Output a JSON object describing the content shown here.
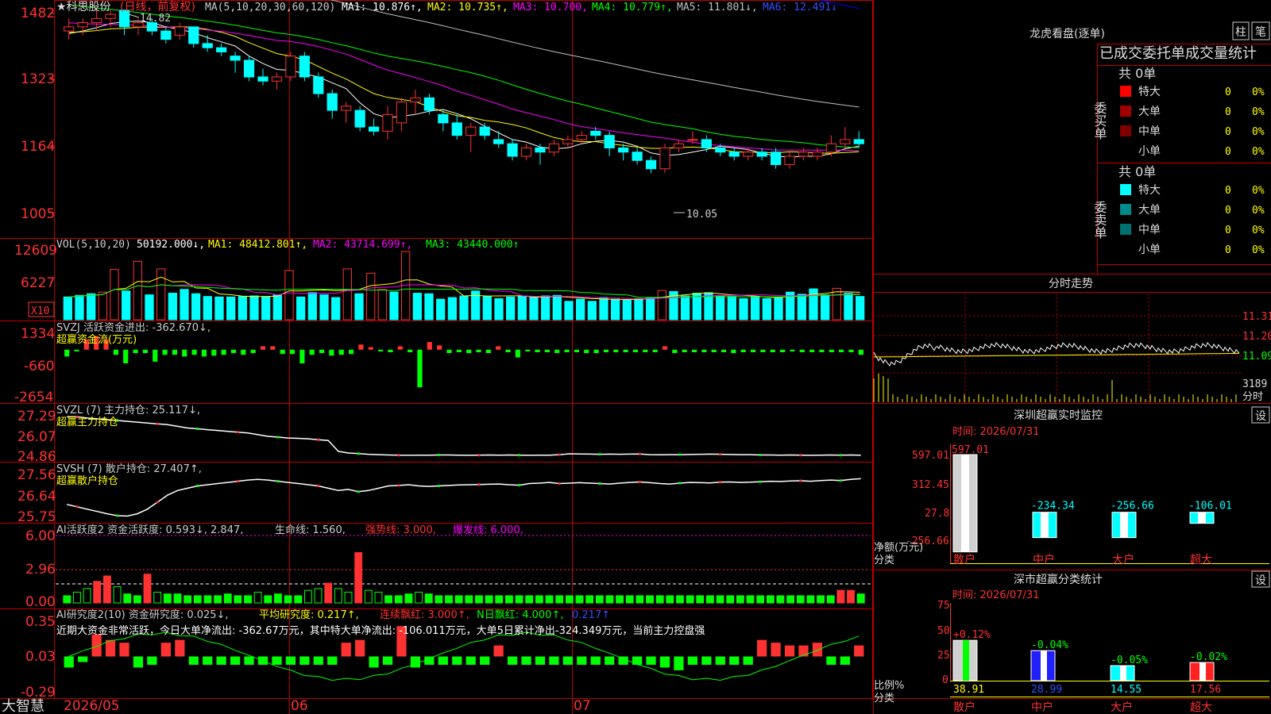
{
  "colors": {
    "up": "#ff3232",
    "down": "#00ffff",
    "buyGreen": "#00ff00",
    "ma1": "#ffffff",
    "ma2": "#ffff00",
    "ma3": "#ff00ff",
    "ma4": "#00ff00",
    "ma5": "#c0c0c0",
    "ma6": "#0000ff",
    "frame": "#c00000"
  },
  "header": {
    "price_max_label": "1482",
    "stock_name": "★科思股份",
    "mode": "(日线，前复权)",
    "ma_params": "MA(5,10,20,30,60,120)",
    "ma1": "MA1: 10.876↑,",
    "ma2": "MA2: 10.735↑,",
    "ma3": "MA3: 10.700,",
    "ma4": "MA4: 10.779↑,",
    "ma5": "MA5: 11.801↓,",
    "ma6": "MA6: 12.491↓"
  },
  "price_panel": {
    "y_ticks": [
      "1323",
      "1164",
      "1005"
    ],
    "high_marker": "14.82",
    "low_marker": "10.05"
  },
  "vol_panel": {
    "title": "VOL(5,10,20)",
    "vol": "50192.000↓,",
    "ma1": "MA1: 48412.801↑,",
    "ma2": "MA2: 43714.699↑,",
    "ma3": "MA3: 43440.000↑",
    "y_ticks": [
      "12609",
      "6227"
    ],
    "unit": "X10"
  },
  "svzj_panel": {
    "title": "SVZJ  活跃资金进出: -362.670↓,",
    "subtitle": "超赢资金流(万元)",
    "y_ticks": [
      "1334",
      "-660",
      "-2654"
    ]
  },
  "svzl_panel": {
    "title": "SVZL (7) 主力持仓: 25.117↓,",
    "subtitle": "超赢主力持仓",
    "y_ticks": [
      "27.29",
      "26.07",
      "24.86"
    ]
  },
  "svsh_panel": {
    "title": "SVSH (7) 散户持仓: 27.407↑,",
    "subtitle": "超赢散户持仓",
    "y_ticks": [
      "27.56",
      "26.64",
      "25.75"
    ]
  },
  "ai1_panel": {
    "title": "AI活跃度2 资金活跃度: 0.593↓, 2.847,",
    "life": "生命线: 1.560,",
    "strong": "强势线: 3.000,",
    "burst": "爆发线: 6.000,",
    "y_ticks": [
      "6.00",
      "2.96",
      "0.00"
    ]
  },
  "ai2_panel": {
    "title": "AI研究度2(10) 资金研究度: 0.025↓,",
    "avg": "平均研究度: 0.217↑,",
    "streak": "连续飘红: 3.000↑,",
    "nday": "N日飘红: 4.000↑,",
    "last": "0.217↑",
    "comment": "近期大资金非常活跃，今日大单净流出: -362.67万元，其中特大单净流出: -106.011万元，大单5日累计净出-324.349万元，当前主力控盘强",
    "y_ticks": [
      "0.35",
      "0.03",
      "-0.29"
    ]
  },
  "bottom": {
    "brand": "大智慧",
    "dates": [
      "2026/05",
      "06",
      "07"
    ]
  },
  "lhb": {
    "title": "龙虎看盘(逐单)",
    "btn_bar": "柱",
    "btn_pen": "笔",
    "header": "已成交委托单成交量统计",
    "buy_label": "委买单",
    "sell_label": "委卖单",
    "buy_total": "共 0单",
    "sell_total": "共 0单",
    "rows": [
      "特大",
      "大单",
      "中单",
      "小单"
    ],
    "count": "0",
    "pct": "0%"
  },
  "fenshi": {
    "title": "分时走势",
    "y_ticks": [
      "11.31",
      "11.20",
      "11.09"
    ],
    "vol_tick": "3189",
    "unit": "分时"
  },
  "realtime": {
    "title": "深圳超赢实时监控",
    "settings": "设",
    "time": "时间: 2026/07/31",
    "y_ticks": [
      "597.01",
      "312.45",
      "27.8",
      "-256.66"
    ],
    "axis_label": "净额(万元)",
    "cat_label": "分类",
    "categories": [
      "散户",
      "中户",
      "大户",
      "超大"
    ],
    "values": [
      "597.01",
      "-234.34",
      "-256.66",
      "-106.01"
    ]
  },
  "classify": {
    "title": "深市超赢分类统计",
    "settings": "设",
    "time": "时间: 2026/07/31",
    "y_ticks": [
      "75",
      "50",
      "25",
      "0"
    ],
    "axis_label": "比例%",
    "cat_label": "分类",
    "categories": [
      "散户",
      "中户",
      "大户",
      "超大"
    ],
    "pct_top": [
      "+0.12%",
      "-0.04%",
      "-0.05%",
      "-0.02%"
    ],
    "pct_bottom": [
      "38.91",
      "28.99",
      "14.55",
      "17.56"
    ]
  },
  "chart_data": [
    {
      "type": "candlestick",
      "title": "科思股份 日线 前复权",
      "ylim": [
        10.05,
        14.82
      ],
      "ohlc": [
        [
          14.4,
          14.7,
          14.2,
          14.5
        ],
        [
          14.5,
          14.7,
          14.3,
          14.6
        ],
        [
          14.6,
          14.9,
          14.4,
          14.7
        ],
        [
          14.7,
          14.9,
          14.5,
          14.8
        ],
        [
          14.9,
          14.8,
          14.3,
          14.5
        ],
        [
          14.5,
          14.7,
          14.3,
          14.6
        ],
        [
          14.6,
          14.7,
          14.3,
          14.4
        ],
        [
          14.4,
          14.5,
          14.1,
          14.2
        ],
        [
          14.3,
          14.6,
          14.2,
          14.5
        ],
        [
          14.5,
          14.5,
          14.0,
          14.1
        ],
        [
          14.1,
          14.3,
          13.9,
          14.0
        ],
        [
          14.0,
          14.1,
          13.8,
          13.9
        ],
        [
          13.8,
          13.9,
          13.4,
          13.7
        ],
        [
          13.7,
          13.8,
          13.2,
          13.3
        ],
        [
          13.3,
          13.5,
          13.1,
          13.2
        ],
        [
          13.2,
          13.4,
          13.0,
          13.3
        ],
        [
          13.3,
          13.9,
          13.2,
          13.8
        ],
        [
          13.8,
          13.9,
          13.2,
          13.3
        ],
        [
          13.3,
          13.4,
          12.8,
          12.9
        ],
        [
          12.9,
          13.0,
          12.3,
          12.5
        ],
        [
          12.5,
          12.7,
          12.2,
          12.6
        ],
        [
          12.5,
          12.6,
          12.0,
          12.1
        ],
        [
          12.1,
          12.3,
          11.9,
          12.0
        ],
        [
          12.0,
          12.6,
          11.8,
          12.4
        ],
        [
          12.2,
          12.8,
          12.0,
          12.7
        ],
        [
          12.7,
          13.0,
          12.4,
          12.8
        ],
        [
          12.8,
          12.9,
          12.4,
          12.5
        ],
        [
          12.4,
          12.5,
          12.0,
          12.2
        ],
        [
          12.2,
          12.4,
          11.8,
          11.9
        ],
        [
          11.9,
          12.2,
          11.5,
          12.1
        ],
        [
          12.1,
          12.2,
          11.8,
          11.9
        ],
        [
          11.8,
          12.0,
          11.6,
          11.7
        ],
        [
          11.7,
          11.8,
          11.3,
          11.4
        ],
        [
          11.4,
          11.7,
          11.3,
          11.6
        ],
        [
          11.6,
          11.7,
          11.2,
          11.5
        ],
        [
          11.5,
          11.8,
          11.4,
          11.7
        ],
        [
          11.7,
          11.9,
          11.6,
          11.8
        ],
        [
          11.8,
          12.0,
          11.7,
          11.9
        ],
        [
          12.0,
          12.1,
          11.8,
          11.9
        ],
        [
          11.9,
          12.0,
          11.4,
          11.6
        ],
        [
          11.6,
          11.7,
          11.3,
          11.5
        ],
        [
          11.5,
          11.6,
          11.2,
          11.3
        ],
        [
          11.3,
          11.4,
          11.0,
          11.1
        ],
        [
          11.1,
          11.7,
          11.0,
          11.6
        ],
        [
          11.6,
          11.8,
          11.5,
          11.7
        ],
        [
          11.8,
          12.0,
          11.7,
          11.8
        ],
        [
          11.8,
          11.9,
          11.5,
          11.6
        ],
        [
          11.6,
          11.7,
          11.4,
          11.5
        ],
        [
          11.5,
          11.6,
          11.3,
          11.4
        ],
        [
          11.4,
          11.6,
          11.3,
          11.5
        ],
        [
          11.5,
          11.6,
          11.3,
          11.4
        ],
        [
          11.5,
          11.6,
          11.1,
          11.2
        ],
        [
          11.2,
          11.5,
          11.1,
          11.4
        ],
        [
          11.4,
          11.6,
          11.3,
          11.5
        ],
        [
          11.4,
          11.6,
          11.3,
          11.5
        ],
        [
          11.5,
          11.9,
          11.4,
          11.7
        ],
        [
          11.7,
          12.1,
          11.6,
          11.8
        ],
        [
          11.8,
          12.0,
          11.6,
          11.7
        ]
      ]
    },
    {
      "type": "bar",
      "title": "VOL(5,10,20)",
      "ylim": [
        0,
        12609
      ],
      "values": [
        4200,
        4500,
        4800,
        5100,
        9300,
        5300,
        10800,
        4600,
        9400,
        4900,
        5600,
        4800,
        4300,
        4200,
        4200,
        4300,
        4400,
        4300,
        4600,
        9100,
        4200,
        5000,
        4600,
        4100,
        9400,
        4800,
        8600,
        5600,
        5100,
        12609,
        4900,
        4800,
        3800,
        4100,
        4400,
        5300,
        4300,
        3900,
        4200,
        4400,
        4100,
        4400,
        4500,
        3400,
        3800,
        3400,
        4100,
        3800,
        3600,
        3900,
        4100,
        5400,
        5200,
        4400,
        4900,
        5000,
        4400,
        4300,
        3900,
        4300,
        3900,
        4100,
        5100,
        4700,
        5700,
        4600,
        5800,
        4900,
        4300
      ]
    },
    {
      "type": "bar",
      "title": "超赢资金流(万元)",
      "ylim": [
        -2654,
        1334
      ],
      "values": [
        -400,
        -100,
        600,
        800,
        600,
        -300,
        -800,
        -200,
        -200,
        -700,
        -300,
        -300,
        -400,
        -300,
        -400,
        -350,
        -300,
        -200,
        -300,
        -200,
        200,
        200,
        -250,
        -250,
        -800,
        -300,
        -200,
        -350,
        -300,
        -250,
        300,
        150,
        -100,
        -150,
        200,
        -150,
        -2200,
        450,
        250,
        -200,
        -150,
        -200,
        -150,
        -200,
        200,
        -150,
        -450,
        -100,
        -150,
        -150,
        -200,
        -150,
        -150,
        -200,
        -200,
        -150,
        -150,
        -150,
        -150,
        -150,
        -150,
        200,
        -200,
        -150,
        -150,
        -150,
        -150,
        -150,
        -200,
        -150,
        -150,
        -150,
        -150,
        -150,
        -100,
        -150,
        -150,
        -150,
        -150,
        -150,
        -150,
        -300
      ]
    },
    {
      "type": "line",
      "title": "超赢主力持仓",
      "ylim": [
        24.86,
        27.29
      ],
      "values": [
        27.28,
        27.27,
        27.2,
        27.15,
        27.1,
        27.05,
        27.0,
        26.95,
        26.9,
        26.85,
        26.8,
        26.7,
        26.6,
        26.55,
        26.5,
        26.45,
        26.4,
        26.35,
        26.3,
        26.2,
        26.1,
        26.05,
        26.0,
        25.98,
        25.95,
        25.9,
        25.85,
        25.2,
        25.1,
        25.06,
        25.02,
        25.0,
        24.98,
        24.97,
        24.96,
        24.97,
        24.97,
        24.98,
        24.98,
        24.97,
        24.96,
        24.97,
        24.98,
        24.97,
        24.98,
        24.97,
        24.96,
        24.97,
        24.97,
        25.0,
        25.05,
        25.04,
        25.03,
        25.02,
        25.03,
        25.02,
        25.03,
        25.04,
        25.0,
        24.99,
        25.0,
        25.0,
        25.01,
        25.02,
        25.03,
        25.02,
        25.01,
        25.0,
        25.0,
        24.98,
        24.98,
        24.97,
        24.98,
        24.97,
        24.96,
        24.97,
        24.98,
        24.97,
        24.98,
        24.96
      ]
    },
    {
      "type": "line",
      "title": "超赢散户持仓",
      "ylim": [
        25.75,
        27.56
      ],
      "values": [
        26.3,
        26.2,
        26.1,
        26.0,
        25.9,
        25.82,
        25.8,
        25.9,
        26.1,
        26.4,
        26.7,
        26.9,
        27.0,
        27.1,
        27.15,
        27.2,
        27.25,
        27.3,
        27.35,
        27.38,
        27.35,
        27.3,
        27.25,
        27.2,
        27.15,
        27.1,
        27.0,
        26.9,
        26.95,
        26.85,
        26.9,
        27.0,
        27.1,
        27.12,
        27.15,
        27.1,
        27.08,
        27.1,
        27.12,
        27.14,
        27.15,
        27.16,
        27.17,
        27.18,
        27.15,
        27.13,
        27.2,
        27.22,
        27.25,
        27.2,
        27.22,
        27.24,
        27.22,
        27.2,
        27.18,
        27.22,
        27.25,
        27.27,
        27.24,
        27.2,
        27.18,
        27.22,
        27.25,
        27.24,
        27.23,
        27.26,
        27.27,
        27.25,
        27.26,
        27.28,
        27.3,
        27.29,
        27.31,
        27.32,
        27.3,
        27.33,
        27.35,
        27.33,
        27.38,
        27.41
      ]
    },
    {
      "type": "bar",
      "title": "AI活跃度2",
      "ylim": [
        0,
        6.0
      ],
      "values": [
        0.4,
        0.6,
        0.8,
        1.2,
        1.5,
        0.9,
        0.5,
        0.4,
        1.6,
        0.6,
        0.5,
        0.5,
        0.4,
        0.4,
        0.4,
        0.4,
        0.5,
        0.4,
        0.4,
        0.6,
        0.4,
        0.5,
        0.4,
        0.4,
        0.7,
        0.8,
        1.1,
        0.8,
        0.6,
        2.8,
        0.7,
        0.6,
        0.4,
        0.4,
        0.5,
        0.6,
        0.5,
        0.4,
        0.4,
        0.4,
        0.4,
        0.4,
        0.4,
        0.4,
        0.4,
        0.4,
        0.4,
        0.4,
        0.4,
        0.4,
        0.4,
        0.4,
        0.4,
        0.4,
        0.4,
        0.4,
        0.4,
        0.4,
        0.4,
        0.4,
        0.4,
        0.4,
        0.4,
        0.4,
        0.4,
        0.4,
        0.4,
        0.4,
        0.4,
        0.4,
        0.4,
        0.4,
        0.4,
        0.4,
        0.4,
        0.4,
        0.4,
        0.7,
        0.7,
        0.5
      ]
    },
    {
      "type": "bar",
      "title": "AI研究度2(10)",
      "ylim": [
        -0.29,
        0.35
      ],
      "values": [
        -0.04,
        -0.02,
        0.08,
        0.06,
        0.05,
        -0.04,
        -0.03,
        0.05,
        0.06,
        -0.03,
        -0.03,
        -0.03,
        -0.03,
        -0.03,
        -0.03,
        -0.03,
        -0.03,
        -0.03,
        -0.03,
        -0.03,
        0.05,
        0.06,
        -0.04,
        -0.03,
        0.11,
        -0.04,
        -0.03,
        -0.03,
        -0.03,
        -0.03,
        -0.03,
        0.04,
        -0.03,
        -0.03,
        -0.03,
        -0.03,
        -0.03,
        -0.03,
        -0.03,
        -0.03,
        -0.03,
        -0.03,
        -0.03,
        -0.04,
        -0.05,
        -0.03,
        -0.03,
        -0.03,
        -0.03,
        -0.03,
        0.06,
        0.05,
        0.04,
        0.04,
        0.05,
        -0.03,
        -0.03,
        0.04
      ]
    },
    {
      "type": "bar",
      "title": "深圳超赢实时监控",
      "ylabel": "净额(万元)",
      "categories": [
        "散户",
        "中户",
        "大户",
        "超大"
      ],
      "values": [
        597.01,
        -234.34,
        -256.66,
        -106.01
      ],
      "ylim": [
        -256.66,
        597.01
      ]
    },
    {
      "type": "bar",
      "title": "深市超赢分类统计",
      "ylabel": "比例%",
      "categories": [
        "散户",
        "中户",
        "大户",
        "超大"
      ],
      "values": [
        38.91,
        28.99,
        14.55,
        17.56
      ],
      "ylim": [
        0,
        75
      ]
    }
  ]
}
